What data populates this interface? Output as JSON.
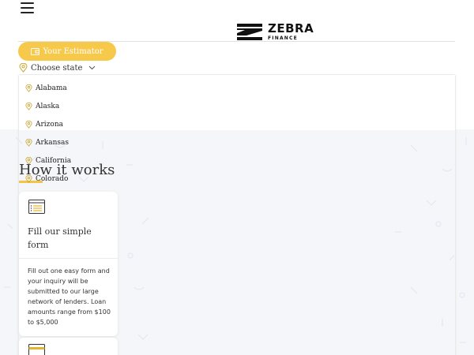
{
  "header": {
    "logo_name": "ZEBRA",
    "logo_sub": "FINANCE"
  },
  "estimator": {
    "label": "Your Estimator"
  },
  "state_select": {
    "label": "Choose state"
  },
  "states": [
    {
      "label": "Alabama"
    },
    {
      "label": "Alaska"
    },
    {
      "label": "Arizona"
    },
    {
      "label": "Arkansas"
    },
    {
      "label": "California"
    },
    {
      "label": "Colorado"
    }
  ],
  "how": {
    "title": "How it works"
  },
  "card": {
    "title": "Fill our simple form",
    "body": "Fill out one easy form and your inquiry will be submitted to our large network of lenders. Loan amounts range from $100 to $5,000"
  },
  "colors": {
    "accent": "#f7c94b",
    "icon_yellow": "#e2b52f",
    "background_gray": "#f4f6f9"
  },
  "icons": {
    "menu": "hamburger-icon",
    "wallet": "wallet-icon",
    "location": "location-pin-icon",
    "chevron": "chevron-down-icon",
    "form": "form-icon",
    "card": "credit-card-icon"
  }
}
